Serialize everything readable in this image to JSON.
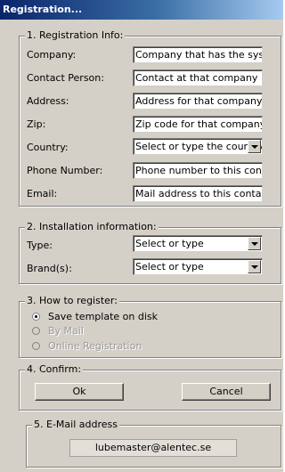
{
  "window": {
    "title": "Registration..."
  },
  "registration": {
    "legend": "1. Registration Info:",
    "fields": [
      {
        "label": "Company:",
        "value": "Company that has the system"
      },
      {
        "label": "Contact Person:",
        "value": "Contact at that company"
      },
      {
        "label": "Address:",
        "value": "Address for that company"
      },
      {
        "label": "Zip:",
        "value": "Zip code for that company"
      },
      {
        "label": "Country:",
        "value": "Select or type the country"
      },
      {
        "label": "Phone Number:",
        "value": "Phone number to this contact"
      },
      {
        "label": "Email:",
        "value": "Mail address to this contact"
      }
    ]
  },
  "installation": {
    "legend": "2. Installation information:",
    "type": {
      "label": "Type:",
      "value": "Select or type"
    },
    "brand": {
      "label": "Brand(s):",
      "value": "Select or type"
    }
  },
  "how": {
    "legend": "3. How to register:",
    "options": [
      {
        "label": "Save template on disk",
        "selected": true,
        "enabled": true
      },
      {
        "label": "By Mail",
        "selected": false,
        "enabled": false
      },
      {
        "label": "Online Registration",
        "selected": false,
        "enabled": false
      }
    ]
  },
  "confirm": {
    "legend": "4. Confirm:",
    "ok_label": "Ok",
    "cancel_label": "Cancel"
  },
  "email_section": {
    "legend": "5. E-Mail address",
    "address": "lubemaster@alentec.se"
  }
}
